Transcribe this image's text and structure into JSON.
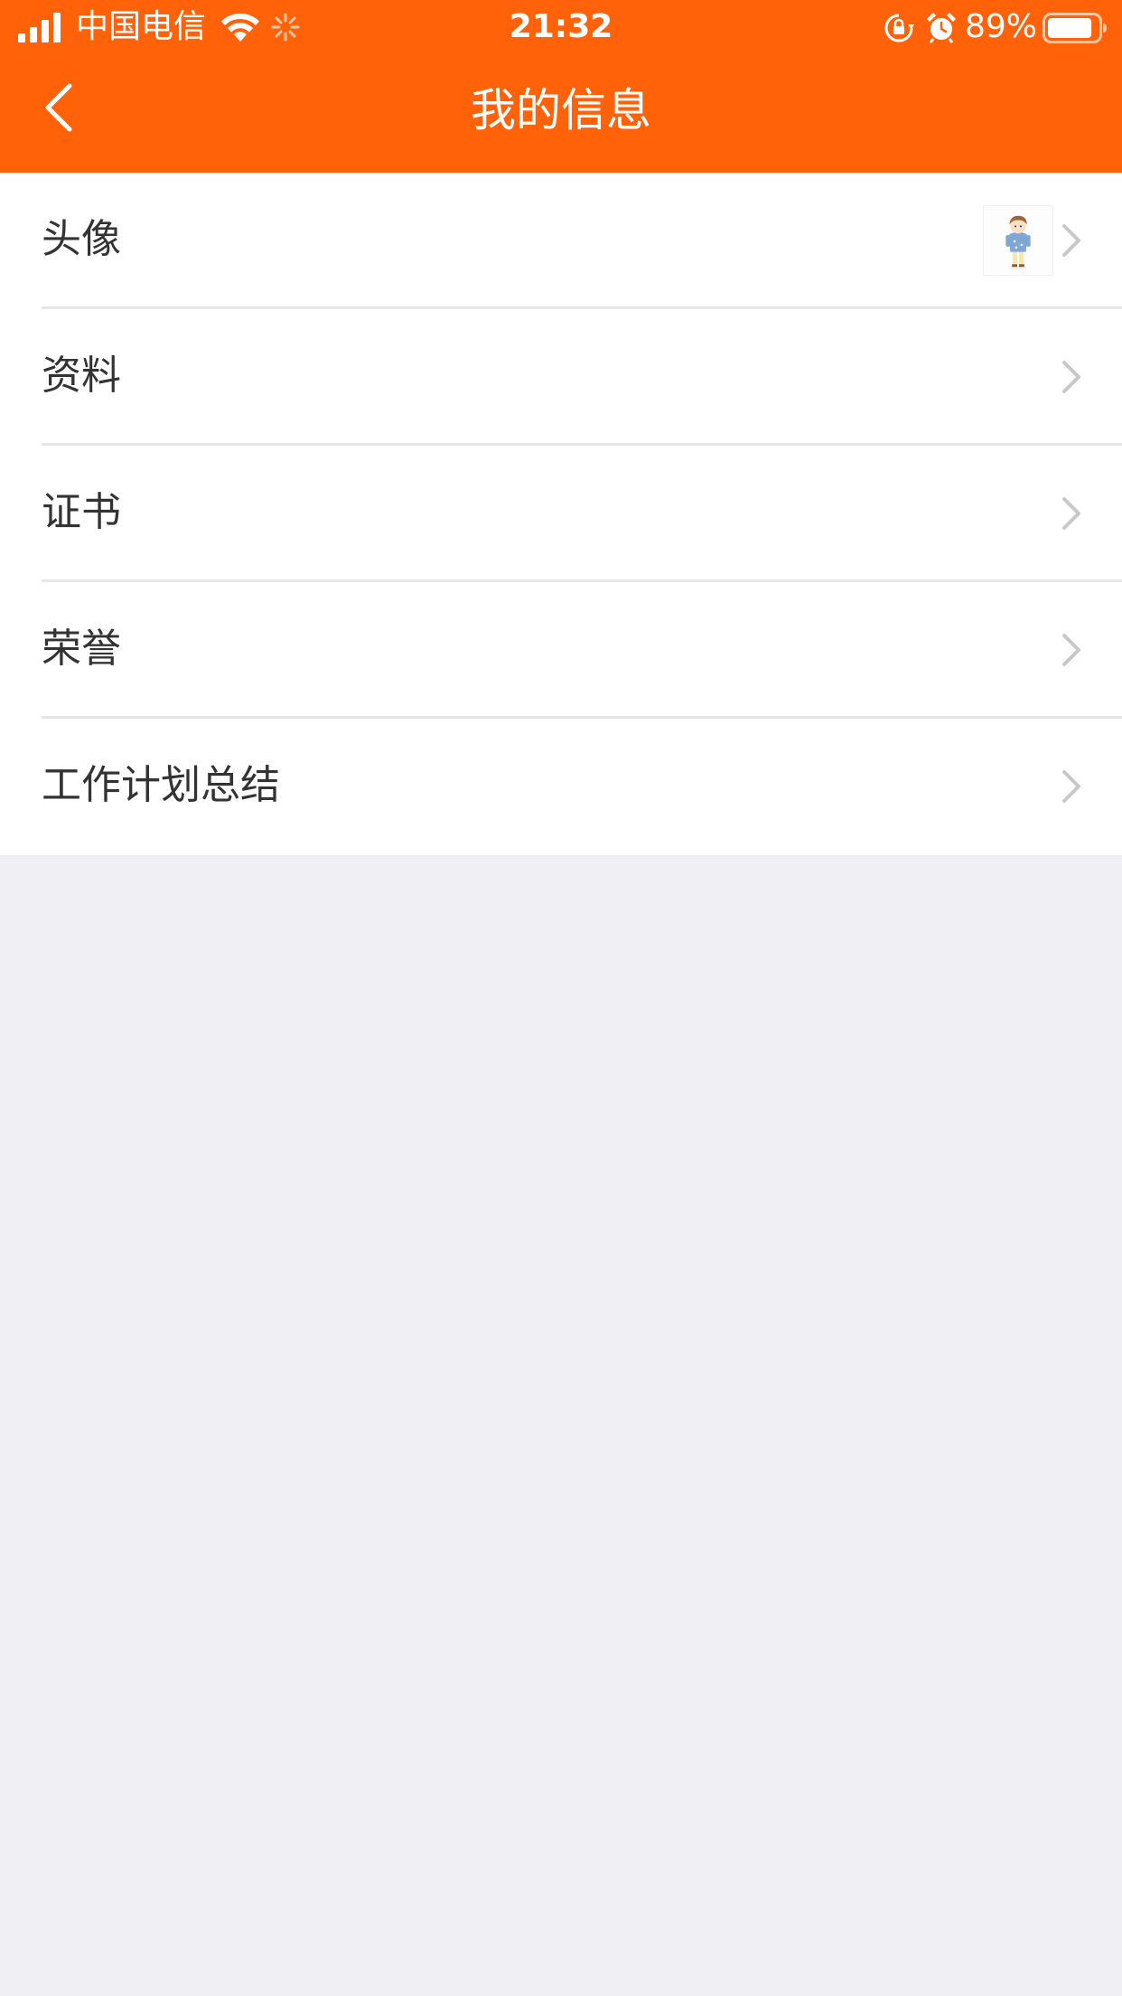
{
  "status_bar": {
    "carrier": "中国电信",
    "time": "21:32",
    "battery_percent": "89%",
    "battery_level": 0.89,
    "icons": [
      "signal-icon",
      "wifi-icon",
      "loading-spinner-icon",
      "rotation-lock-icon",
      "alarm-icon",
      "battery-icon"
    ]
  },
  "nav": {
    "title": "我的信息",
    "back_icon": "chevron-left-icon"
  },
  "colors": {
    "header": "#ff6208",
    "page_background": "#efeff4",
    "row_background": "#ffffff",
    "text": "#333333",
    "chevron": "#c7c7cc"
  },
  "menu": {
    "items": [
      {
        "label": "头像",
        "has_avatar": true
      },
      {
        "label": "资料"
      },
      {
        "label": "证书"
      },
      {
        "label": "荣誉"
      },
      {
        "label": "工作计划总结"
      }
    ]
  }
}
